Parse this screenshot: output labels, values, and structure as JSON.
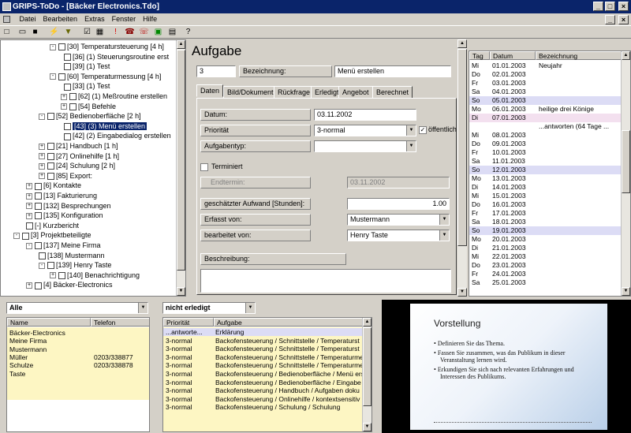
{
  "window": {
    "title": "GRIPS-ToDo - [Bäcker Electronics.Tdo]"
  },
  "menu": [
    "Datei",
    "Bearbeiten",
    "Extras",
    "Fenster",
    "Hilfe"
  ],
  "toolbar_icons": [
    "new-icon",
    "open-icon",
    "save-icon",
    "wand-icon",
    "filter-icon",
    "checkbox-icon",
    "calendar-icon",
    "exclamation-icon",
    "phone-icon",
    "phone2-icon",
    "bus-icon",
    "document-icon",
    "help-icon"
  ],
  "tree": [
    {
      "text": "[30] Temperatursteuerung  [4 h]",
      "exp": "-"
    },
    {
      "text": "[36] (1) Steuerungsroutine erst",
      "exp": ""
    },
    {
      "text": "[39] (1) Test",
      "exp": ""
    },
    {
      "text": "[60] Temperaturmessung  [4 h]",
      "exp": "-"
    },
    {
      "text": "[33] (1) Test",
      "exp": ""
    },
    {
      "text": "[62] (1) Meßroutine erstellen",
      "exp": "+"
    },
    {
      "text": "[54] Befehle",
      "exp": "+"
    },
    {
      "text": "[52] Bedienoberfläche  [2 h]",
      "exp": "-"
    },
    {
      "text": "[43] (3) Menü erstellen",
      "exp": ""
    },
    {
      "text": "[42] (2) Eingabedialog erstellen",
      "exp": ""
    },
    {
      "text": "[21] Handbuch  [1 h]",
      "exp": "+"
    },
    {
      "text": "[27] Onlinehilfe  [1 h]",
      "exp": "+"
    },
    {
      "text": "[24] Schulung  [2 h]",
      "exp": "+"
    },
    {
      "text": "[85] Export:",
      "exp": "+"
    },
    {
      "text": "[6] Kontakte",
      "exp": "+"
    },
    {
      "text": "[13] Fakturierung",
      "exp": "+"
    },
    {
      "text": "[132] Besprechungen",
      "exp": "+"
    },
    {
      "text": "[135] Konfiguration",
      "exp": "+"
    },
    {
      "text": "[-] Kurzbericht",
      "exp": ""
    },
    {
      "text": "[3] Projektbeteiligte",
      "exp": "-"
    },
    {
      "text": "[137] Meine Firma",
      "exp": "-"
    },
    {
      "text": "[138] Mustermann",
      "exp": ""
    },
    {
      "text": "[139] Henry Taste",
      "exp": "-"
    },
    {
      "text": "[140] Benachrichtigung",
      "exp": "+"
    },
    {
      "text": "[4] Bäcker-Electronics",
      "exp": "+"
    }
  ],
  "task": {
    "heading": "Aufgabe",
    "id_value": "3",
    "bezeichnung_label": "Bezeichnung:",
    "bezeichnung_value": "Menü erstellen",
    "tabs": [
      "Daten",
      "Bild/Dokument",
      "Rückfrage",
      "Erledigt",
      "Angebot",
      "Berechnet"
    ],
    "datum_label": "Datum:",
    "datum_value": "03.11.2002",
    "prioritaet_label": "Priorität",
    "prioritaet_value": "3-normal",
    "oeffentlich_label": "öffentlich",
    "aufgabentyp_label": "Aufgabentyp:",
    "aufgabentyp_value": "",
    "terminiert_label": "Terminiert",
    "endtermin_label": "Endtermin:",
    "endtermin_value": "03.11.2002",
    "aufwand_label": "geschätzter Aufwand [Stunden]:",
    "aufwand_value": "1.00",
    "erfasst_label": "Erfasst von:",
    "erfasst_value": "Mustermann",
    "bearbeitet_label": "bearbeitet von:",
    "bearbeitet_value": "Henry Taste",
    "beschreibung_label": "Beschreibung:"
  },
  "calendar": {
    "headers": [
      "Tag",
      "Datum",
      "Bezeichnung"
    ],
    "rows": [
      {
        "tag": "Mi",
        "datum": "01.01.2003",
        "bez": "Neujahr",
        "hl": false
      },
      {
        "tag": "Do",
        "datum": "02.01.2003",
        "bez": "",
        "hl": false
      },
      {
        "tag": "Fr",
        "datum": "03.01.2003",
        "bez": "",
        "hl": false
      },
      {
        "tag": "Sa",
        "datum": "04.01.2003",
        "bez": "",
        "hl": false
      },
      {
        "tag": "So",
        "datum": "05.01.2003",
        "bez": "",
        "hl": true
      },
      {
        "tag": "Mo",
        "datum": "06.01.2003",
        "bez": "heilige drei Könige",
        "hl": false
      },
      {
        "tag": "Di",
        "datum": "07.01.2003",
        "bez": "",
        "hl": true
      },
      {
        "tag": "",
        "datum": "",
        "bez": "...antworten (64 Tage ...",
        "hl": false
      },
      {
        "tag": "Mi",
        "datum": "08.01.2003",
        "bez": "",
        "hl": false
      },
      {
        "tag": "Do",
        "datum": "09.01.2003",
        "bez": "",
        "hl": false
      },
      {
        "tag": "Fr",
        "datum": "10.01.2003",
        "bez": "",
        "hl": false
      },
      {
        "tag": "Sa",
        "datum": "11.01.2003",
        "bez": "",
        "hl": false
      },
      {
        "tag": "So",
        "datum": "12.01.2003",
        "bez": "",
        "hl": true
      },
      {
        "tag": "Mo",
        "datum": "13.01.2003",
        "bez": "",
        "hl": false
      },
      {
        "tag": "Di",
        "datum": "14.01.2003",
        "bez": "",
        "hl": false
      },
      {
        "tag": "Mi",
        "datum": "15.01.2003",
        "bez": "",
        "hl": false
      },
      {
        "tag": "Do",
        "datum": "16.01.2003",
        "bez": "",
        "hl": false
      },
      {
        "tag": "Fr",
        "datum": "17.01.2003",
        "bez": "",
        "hl": false
      },
      {
        "tag": "Sa",
        "datum": "18.01.2003",
        "bez": "",
        "hl": false
      },
      {
        "tag": "So",
        "datum": "19.01.2003",
        "bez": "",
        "hl": true
      },
      {
        "tag": "Mo",
        "datum": "20.01.2003",
        "bez": "",
        "hl": false
      },
      {
        "tag": "Di",
        "datum": "21.01.2003",
        "bez": "",
        "hl": false
      },
      {
        "tag": "Mi",
        "datum": "22.01.2003",
        "bez": "",
        "hl": false
      },
      {
        "tag": "Do",
        "datum": "23.01.2003",
        "bez": "",
        "hl": false
      },
      {
        "tag": "Fr",
        "datum": "24.01.2003",
        "bez": "",
        "hl": false
      },
      {
        "tag": "Sa",
        "datum": "25.01.2003",
        "bez": "",
        "hl": false
      }
    ]
  },
  "contacts": {
    "filter_value": "Alle",
    "headers": [
      "Name",
      "Telefon"
    ],
    "rows": [
      {
        "name": "Bäcker-Electronics",
        "tel": ""
      },
      {
        "name": "Meine Firma",
        "tel": ""
      },
      {
        "name": "Mustermann",
        "tel": ""
      },
      {
        "name": "Müller",
        "tel": "0203/338877"
      },
      {
        "name": "Schulze",
        "tel": "0203/338878"
      },
      {
        "name": "Taste",
        "tel": ""
      }
    ]
  },
  "todo": {
    "filter_value": "nicht erledigt",
    "headers": [
      "Priorität",
      "Aufgabe"
    ],
    "rows": [
      {
        "prio": "...antworte...",
        "aufgabe": "Erklärung"
      },
      {
        "prio": "3-normal",
        "aufgabe": "Backofensteuerung / Schnittstelle / Temperaturst"
      },
      {
        "prio": "3-normal",
        "aufgabe": "Backofensteuerung / Schnittstelle / Temperaturst"
      },
      {
        "prio": "3-normal",
        "aufgabe": "Backofensteuerung / Schnittstelle / Temperaturme"
      },
      {
        "prio": "3-normal",
        "aufgabe": "Backofensteuerung / Schnittstelle / Temperaturme"
      },
      {
        "prio": "3-normal",
        "aufgabe": "Backofensteuerung / Bedienoberfläche / Menü ers"
      },
      {
        "prio": "3-normal",
        "aufgabe": "Backofensteuerung / Bedienoberfläche / Eingabe"
      },
      {
        "prio": "3-normal",
        "aufgabe": "Backofensteuerung / Handbuch / Aufgaben doku"
      },
      {
        "prio": "3-normal",
        "aufgabe": "Backofensteuerung / Onlinehilfe / kontextsensitiv"
      },
      {
        "prio": "3-normal",
        "aufgabe": "Backofensteuerung / Schulung / Schulung"
      }
    ]
  },
  "slide": {
    "title": "Vorstellung",
    "bullets": [
      "Definieren Sie das Thema.",
      "Fassen Sie zusammen, was das Publikum in dieser Veranstaltung lernen wird.",
      "Erkundigen Sie sich nach relevanten Erfahrungen und Interessen des Publikums."
    ]
  }
}
